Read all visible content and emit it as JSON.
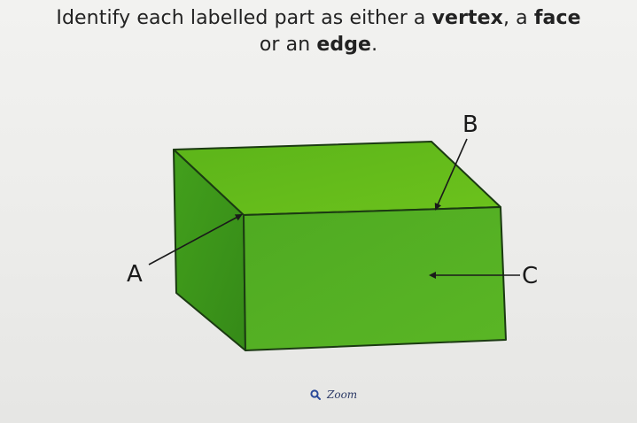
{
  "question": {
    "prefix": "Identify each labelled part as either a ",
    "vertex": "vertex",
    "middle": ", a ",
    "face": "face",
    "line2_prefix": "or an ",
    "edge": "edge",
    "suffix": "."
  },
  "figure": {
    "labels": {
      "a": "A",
      "b": "B",
      "c": "C"
    },
    "colors": {
      "top_face": "#63bb1a",
      "front_face": "#54b020",
      "side_face": "#3f9a1c",
      "outline": "#1b3a12"
    }
  },
  "zoom": {
    "icon": "magnifier-icon",
    "label": "Zoom"
  }
}
